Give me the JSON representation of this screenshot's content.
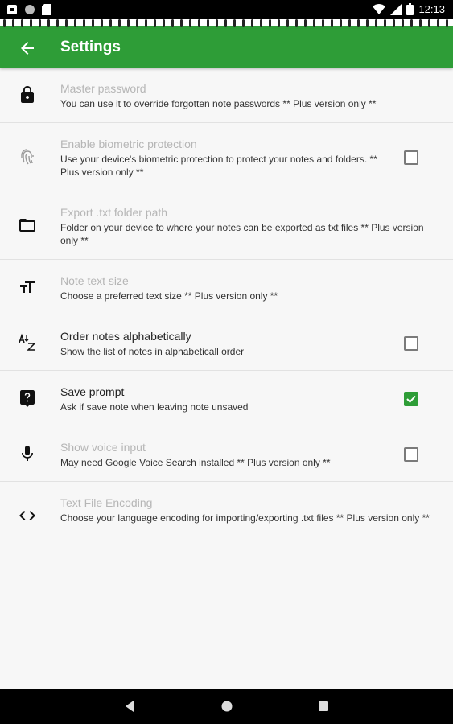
{
  "status_bar": {
    "time": "12:13"
  },
  "app_bar": {
    "title": "Settings",
    "back_icon": "arrow-left-icon"
  },
  "settings": [
    {
      "title": "Master password",
      "summary": "You can use it to override forgotten note passwords ** Plus version only **",
      "enabled": false,
      "icon": "lock-icon",
      "checkbox": null
    },
    {
      "title": "Enable biometric protection",
      "summary": "Use your device's biometric protection to protect your notes and folders. ** Plus version only **",
      "enabled": false,
      "icon": "fingerprint-icon",
      "checkbox": false
    },
    {
      "title": "Export .txt folder path",
      "summary": "Folder on your device to where your notes can be exported as txt files ** Plus version only **",
      "enabled": false,
      "icon": "folder-icon",
      "checkbox": null
    },
    {
      "title": "Note text size",
      "summary": "Choose a preferred text size ** Plus version only **",
      "enabled": false,
      "icon": "text-size-icon",
      "checkbox": null
    },
    {
      "title": "Order notes alphabetically",
      "summary": "Show the list of notes in alphabeticall order",
      "enabled": true,
      "icon": "sort-alpha-icon",
      "checkbox": false
    },
    {
      "title": "Save prompt",
      "summary": "Ask if save note when leaving note unsaved",
      "enabled": true,
      "icon": "question-icon",
      "checkbox": true
    },
    {
      "title": "Show voice input",
      "summary": "May need Google Voice Search installed ** Plus version only **",
      "enabled": false,
      "icon": "microphone-icon",
      "checkbox": false
    },
    {
      "title": "Text File Encoding",
      "summary": "Choose your language encoding for importing/exporting .txt files ** Plus version only **",
      "enabled": false,
      "icon": "code-icon",
      "checkbox": null
    }
  ],
  "colors": {
    "primary": "#2e9d37",
    "disabled_text": "#b6b6b6"
  }
}
